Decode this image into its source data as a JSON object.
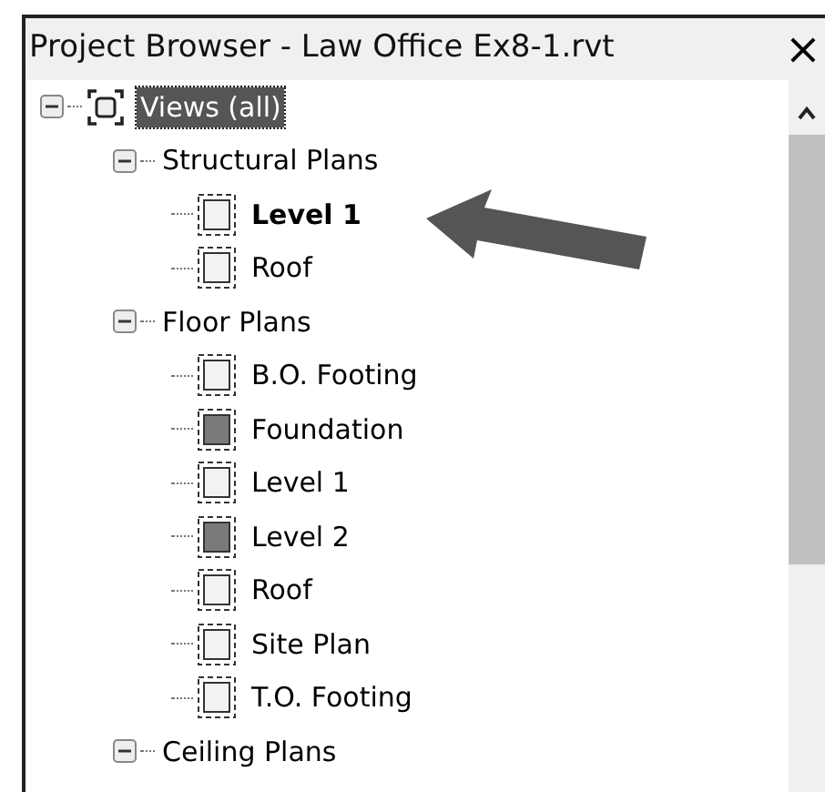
{
  "window": {
    "title": "Project Browser - Law Office Ex8-1.rvt",
    "close": "×"
  },
  "tree": [
    {
      "label": "Views (all)",
      "selected": true,
      "bold": false,
      "expanded": true,
      "children": [
        {
          "label": "Structural Plans",
          "selected": false,
          "bold": false,
          "expanded": true,
          "children": [
            {
              "label": "Level 1",
              "selected": false,
              "bold": true,
              "shaded": false
            },
            {
              "label": "Roof",
              "selected": false,
              "bold": false,
              "shaded": false
            }
          ]
        },
        {
          "label": "Floor Plans",
          "selected": false,
          "bold": false,
          "expanded": true,
          "children": [
            {
              "label": "B.O. Footing",
              "selected": false,
              "bold": false,
              "shaded": false
            },
            {
              "label": "Foundation",
              "selected": false,
              "bold": false,
              "shaded": true
            },
            {
              "label": "Level 1",
              "selected": false,
              "bold": false,
              "shaded": false
            },
            {
              "label": "Level 2",
              "selected": false,
              "bold": false,
              "shaded": true
            },
            {
              "label": "Roof",
              "selected": false,
              "bold": false,
              "shaded": false
            },
            {
              "label": "Site Plan",
              "selected": false,
              "bold": false,
              "shaded": false
            },
            {
              "label": "T.O. Footing",
              "selected": false,
              "bold": false,
              "shaded": false
            }
          ]
        },
        {
          "label": "Ceiling Plans",
          "selected": false,
          "bold": false,
          "expanded": true
        }
      ]
    }
  ]
}
